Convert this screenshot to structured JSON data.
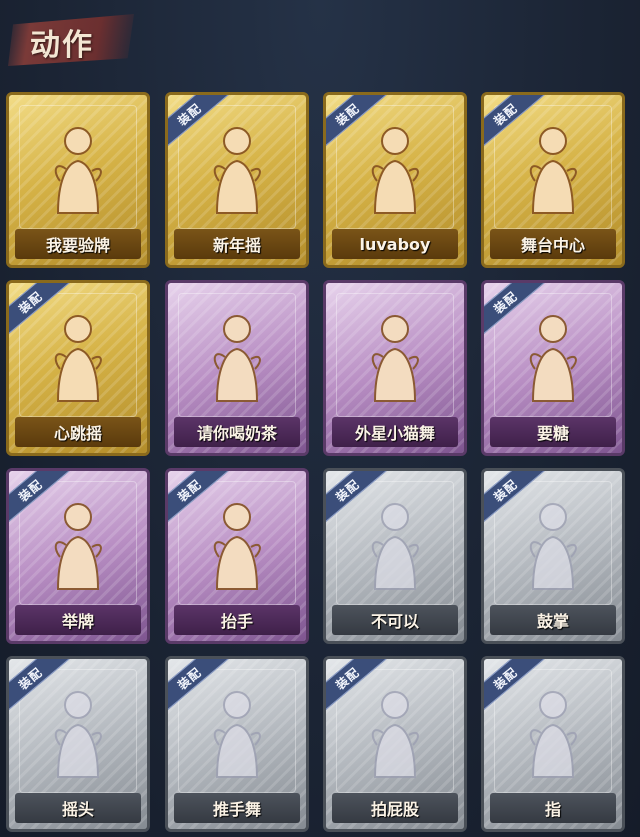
{
  "section_title": "动作",
  "equipped_badge": "装配",
  "cards": [
    {
      "label": "我要验牌",
      "rarity": "gold",
      "equipped": false,
      "icon": "figure-hold-card-icon"
    },
    {
      "label": "新年摇",
      "rarity": "gold",
      "equipped": true,
      "icon": "figure-wave-icon"
    },
    {
      "label": "luvaboy",
      "rarity": "gold",
      "equipped": true,
      "icon": "figure-pose-icon"
    },
    {
      "label": "舞台中心",
      "rarity": "gold",
      "equipped": true,
      "icon": "figure-sparkle-icon"
    },
    {
      "label": "心跳摇",
      "rarity": "gold",
      "equipped": true,
      "icon": "figure-raise-hand-icon"
    },
    {
      "label": "请你喝奶茶",
      "rarity": "purple",
      "equipped": false,
      "icon": "figure-hold-sign-icon"
    },
    {
      "label": "外星小猫舞",
      "rarity": "purple",
      "equipped": false,
      "icon": "figure-dance-icon"
    },
    {
      "label": "要糖",
      "rarity": "purple",
      "equipped": true,
      "icon": "figure-reach-icon"
    },
    {
      "label": "举牌",
      "rarity": "purple",
      "equipped": true,
      "icon": "figure-hold-board-icon"
    },
    {
      "label": "抬手",
      "rarity": "purple",
      "equipped": true,
      "icon": "figure-lift-hand-icon"
    },
    {
      "label": "不可以",
      "rarity": "grey",
      "equipped": true,
      "icon": "finger-wag-icon"
    },
    {
      "label": "鼓掌",
      "rarity": "grey",
      "equipped": true,
      "icon": "clap-hands-icon"
    },
    {
      "label": "摇头",
      "rarity": "grey",
      "equipped": true,
      "icon": "figure-shake-head-icon"
    },
    {
      "label": "推手舞",
      "rarity": "grey",
      "equipped": true,
      "icon": "figure-push-dance-icon"
    },
    {
      "label": "拍屁股",
      "rarity": "grey",
      "equipped": true,
      "icon": "figure-pat-icon"
    },
    {
      "label": "指",
      "rarity": "grey",
      "equipped": true,
      "icon": "pointing-hand-icon"
    }
  ]
}
